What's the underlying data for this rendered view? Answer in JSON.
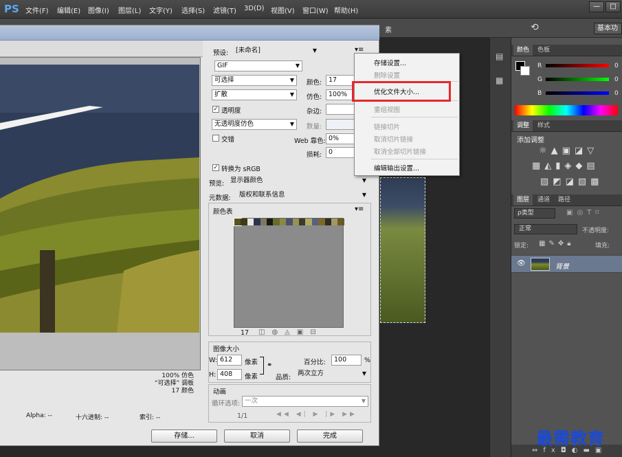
{
  "app": {
    "logo": "PS"
  },
  "menu": [
    "文件(F)",
    "编辑(E)",
    "图像(I)",
    "图层(L)",
    "文字(Y)",
    "选择(S)",
    "滤镜(T)",
    "3D(D)",
    "视图(V)",
    "窗口(W)",
    "帮助(H)"
  ],
  "window_buttons": [
    "—",
    "□"
  ],
  "options_bar": {
    "text": "素",
    "workspace": "基本功"
  },
  "dialog": {
    "preset_label": "预设:",
    "preset_value": "[未命名]",
    "format": "GIF",
    "reduction": "可选择",
    "colors_label": "颜色:",
    "colors_value": "17",
    "dither_algo": "扩散",
    "dither_label": "仿色:",
    "dither_value": "100%",
    "transparency_label": "透明度",
    "matte_label": "杂边:",
    "trans_dither": "无透明度仿色",
    "amount_label": "数量:",
    "interlaced_label": "交错",
    "websnap_label": "Web 靠色:",
    "websnap_value": "0%",
    "lossy_label": "损耗:",
    "lossy_value": "0",
    "convert_srgb": "转换为 sRGB",
    "preview_label": "预览:",
    "preview_value": "显示器颜色",
    "metadata_label": "元数据:",
    "metadata_value": "版权和联系信息",
    "color_table_title": "颜色表",
    "color_count": "17",
    "swatches": [
      "#5a5220",
      "#3e3a18",
      "#e8e8e0",
      "#2a3450",
      "#7a7a60",
      "#1a1a10",
      "#6a6a30",
      "#8a8a40",
      "#4a5070",
      "#9a9050",
      "#3a3a2a",
      "#b0a860",
      "#5a6080",
      "#7a6a28",
      "#2e2e20",
      "#a09868",
      "#6a5a20"
    ],
    "image_size_title": "图像大小",
    "w_label": "W:",
    "w_value": "612",
    "h_label": "H:",
    "h_value": "408",
    "unit": "像素",
    "percent_label": "百分比:",
    "percent_value": "100",
    "percent_unit": "%",
    "quality_label": "品质:",
    "quality_value": "两次立方",
    "anim_title": "动画",
    "loop_label": "循环选项:",
    "loop_value": "一次",
    "frame_counter": "1/1",
    "info_lines": [
      "100% 仿色",
      "“可选择” 调板",
      "17 颜色"
    ],
    "status": {
      "alpha": "Alpha: --",
      "hex": "十六进制: --",
      "index": "索引: --"
    },
    "buttons": {
      "save": "存储...",
      "cancel": "取消",
      "done": "完成"
    }
  },
  "flyout_menu": [
    {
      "label": "存储设置...",
      "enabled": true
    },
    {
      "label": "删除设置",
      "enabled": false
    },
    {
      "label": "优化文件大小...",
      "enabled": true
    },
    {
      "label": "重组视图",
      "enabled": false
    },
    {
      "label": "链接切片",
      "enabled": false
    },
    {
      "label": "取消切片链接",
      "enabled": false
    },
    {
      "label": "取消全部切片链接",
      "enabled": false
    },
    {
      "label": "编辑输出设置...",
      "enabled": true
    }
  ],
  "panels": {
    "color_tabs": [
      "颜色",
      "色板"
    ],
    "channels": [
      "R",
      "G",
      "B"
    ],
    "channel_values": [
      "0",
      "0",
      "0"
    ],
    "adjust_tabs": [
      "调整",
      "样式"
    ],
    "adjust_title": "添加调整",
    "layer_tabs": [
      "图层",
      "通道",
      "路径"
    ],
    "layer_filter": "ρ类型",
    "blend_mode": "正常",
    "opacity_label": "不透明度:",
    "lock_label": "锁定:",
    "fill_label": "填充:",
    "layer_name": "背景"
  },
  "watermark": "最需教育"
}
